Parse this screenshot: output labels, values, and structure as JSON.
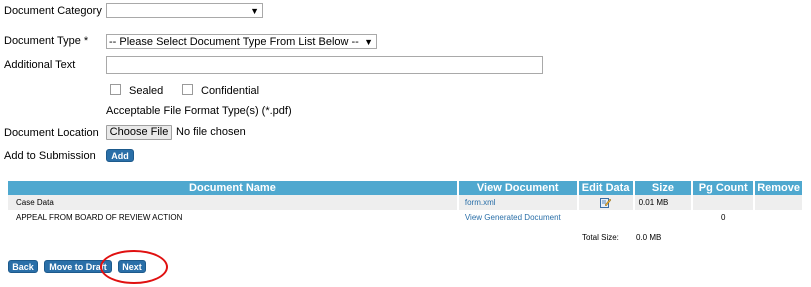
{
  "form": {
    "document_category_label": "Document Category",
    "document_category_value": "",
    "document_type_label": "Document Type *",
    "document_type_value": "-- Please Select Document Type From List Below --",
    "additional_text_label": "Additional Text",
    "additional_text_value": "",
    "sealed_label": "Sealed",
    "confidential_label": "Confidential",
    "file_format_note": "Acceptable File Format Type(s) (*.pdf)",
    "document_location_label": "Document Location",
    "choose_file_label": "Choose File",
    "no_file_text": "No file chosen",
    "add_to_submission_label": "Add to Submission",
    "add_button_label": "Add"
  },
  "table": {
    "headers": [
      "Document Name",
      "View Document",
      "Edit Data",
      "Size",
      "Pg Count",
      "Remove"
    ],
    "rows": [
      {
        "name": "Case Data",
        "view": "form.xml",
        "edit_icon": "edit-icon",
        "size": "0.01 MB",
        "pg_count": "",
        "remove": ""
      },
      {
        "name": "APPEAL FROM BOARD OF REVIEW ACTION",
        "view": "View Generated Document",
        "edit_icon": "",
        "size": "",
        "pg_count": "0",
        "remove": ""
      }
    ],
    "total_size_label": "Total Size:",
    "total_size_value": "0.0 MB"
  },
  "footer": {
    "back_label": "Back",
    "move_to_draft_label": "Move to Draft",
    "next_label": "Next"
  },
  "colors": {
    "header_bg": "#4fa8cf",
    "button_bg": "#2a6fa8",
    "link": "#2a6fa8",
    "highlight_ring": "#e01010"
  }
}
